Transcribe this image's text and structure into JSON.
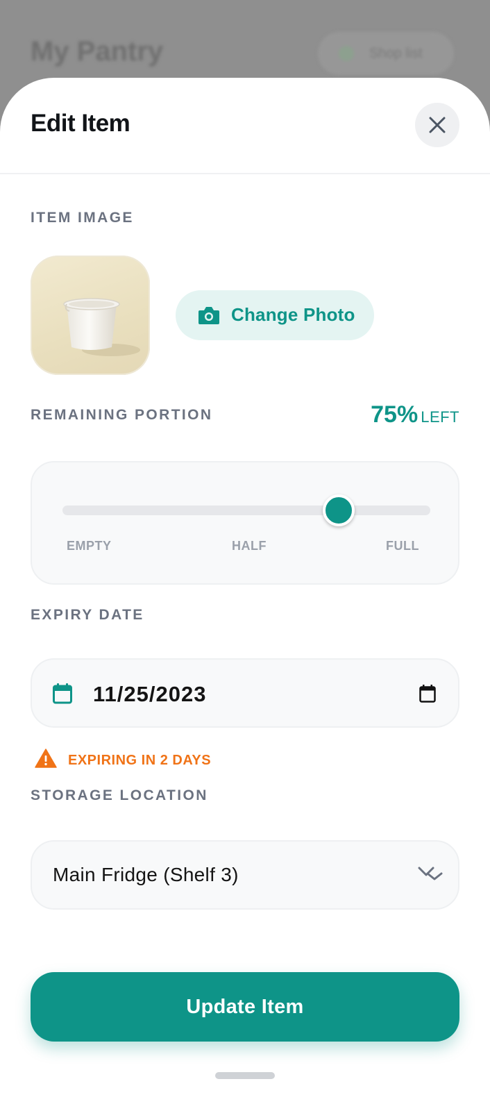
{
  "background": {
    "title": "My Pantry",
    "pill_label": "Shop list"
  },
  "sheet": {
    "title": "Edit Item",
    "close_icon": "close-icon"
  },
  "item_image": {
    "label": "ITEM IMAGE",
    "change_photo_label": "Change Photo",
    "camera_icon": "camera-icon"
  },
  "portion": {
    "label": "REMAINING PORTION",
    "value_text": "75%",
    "unit_text": "LEFT",
    "value": 0.75,
    "ticks": [
      "EMPTY",
      "HALF",
      "FULL"
    ]
  },
  "expiry": {
    "label": "EXPIRY DATE",
    "value": "11/25/2023",
    "warning": "EXPIRING IN 2 DAYS",
    "warning_icon": "warning-icon"
  },
  "storage": {
    "label": "STORAGE LOCATION",
    "value": "Main Fridge (Shelf 3)"
  },
  "update_button": "Update Item",
  "colors": {
    "accent": "#0e9488",
    "warning": "#f07317"
  }
}
